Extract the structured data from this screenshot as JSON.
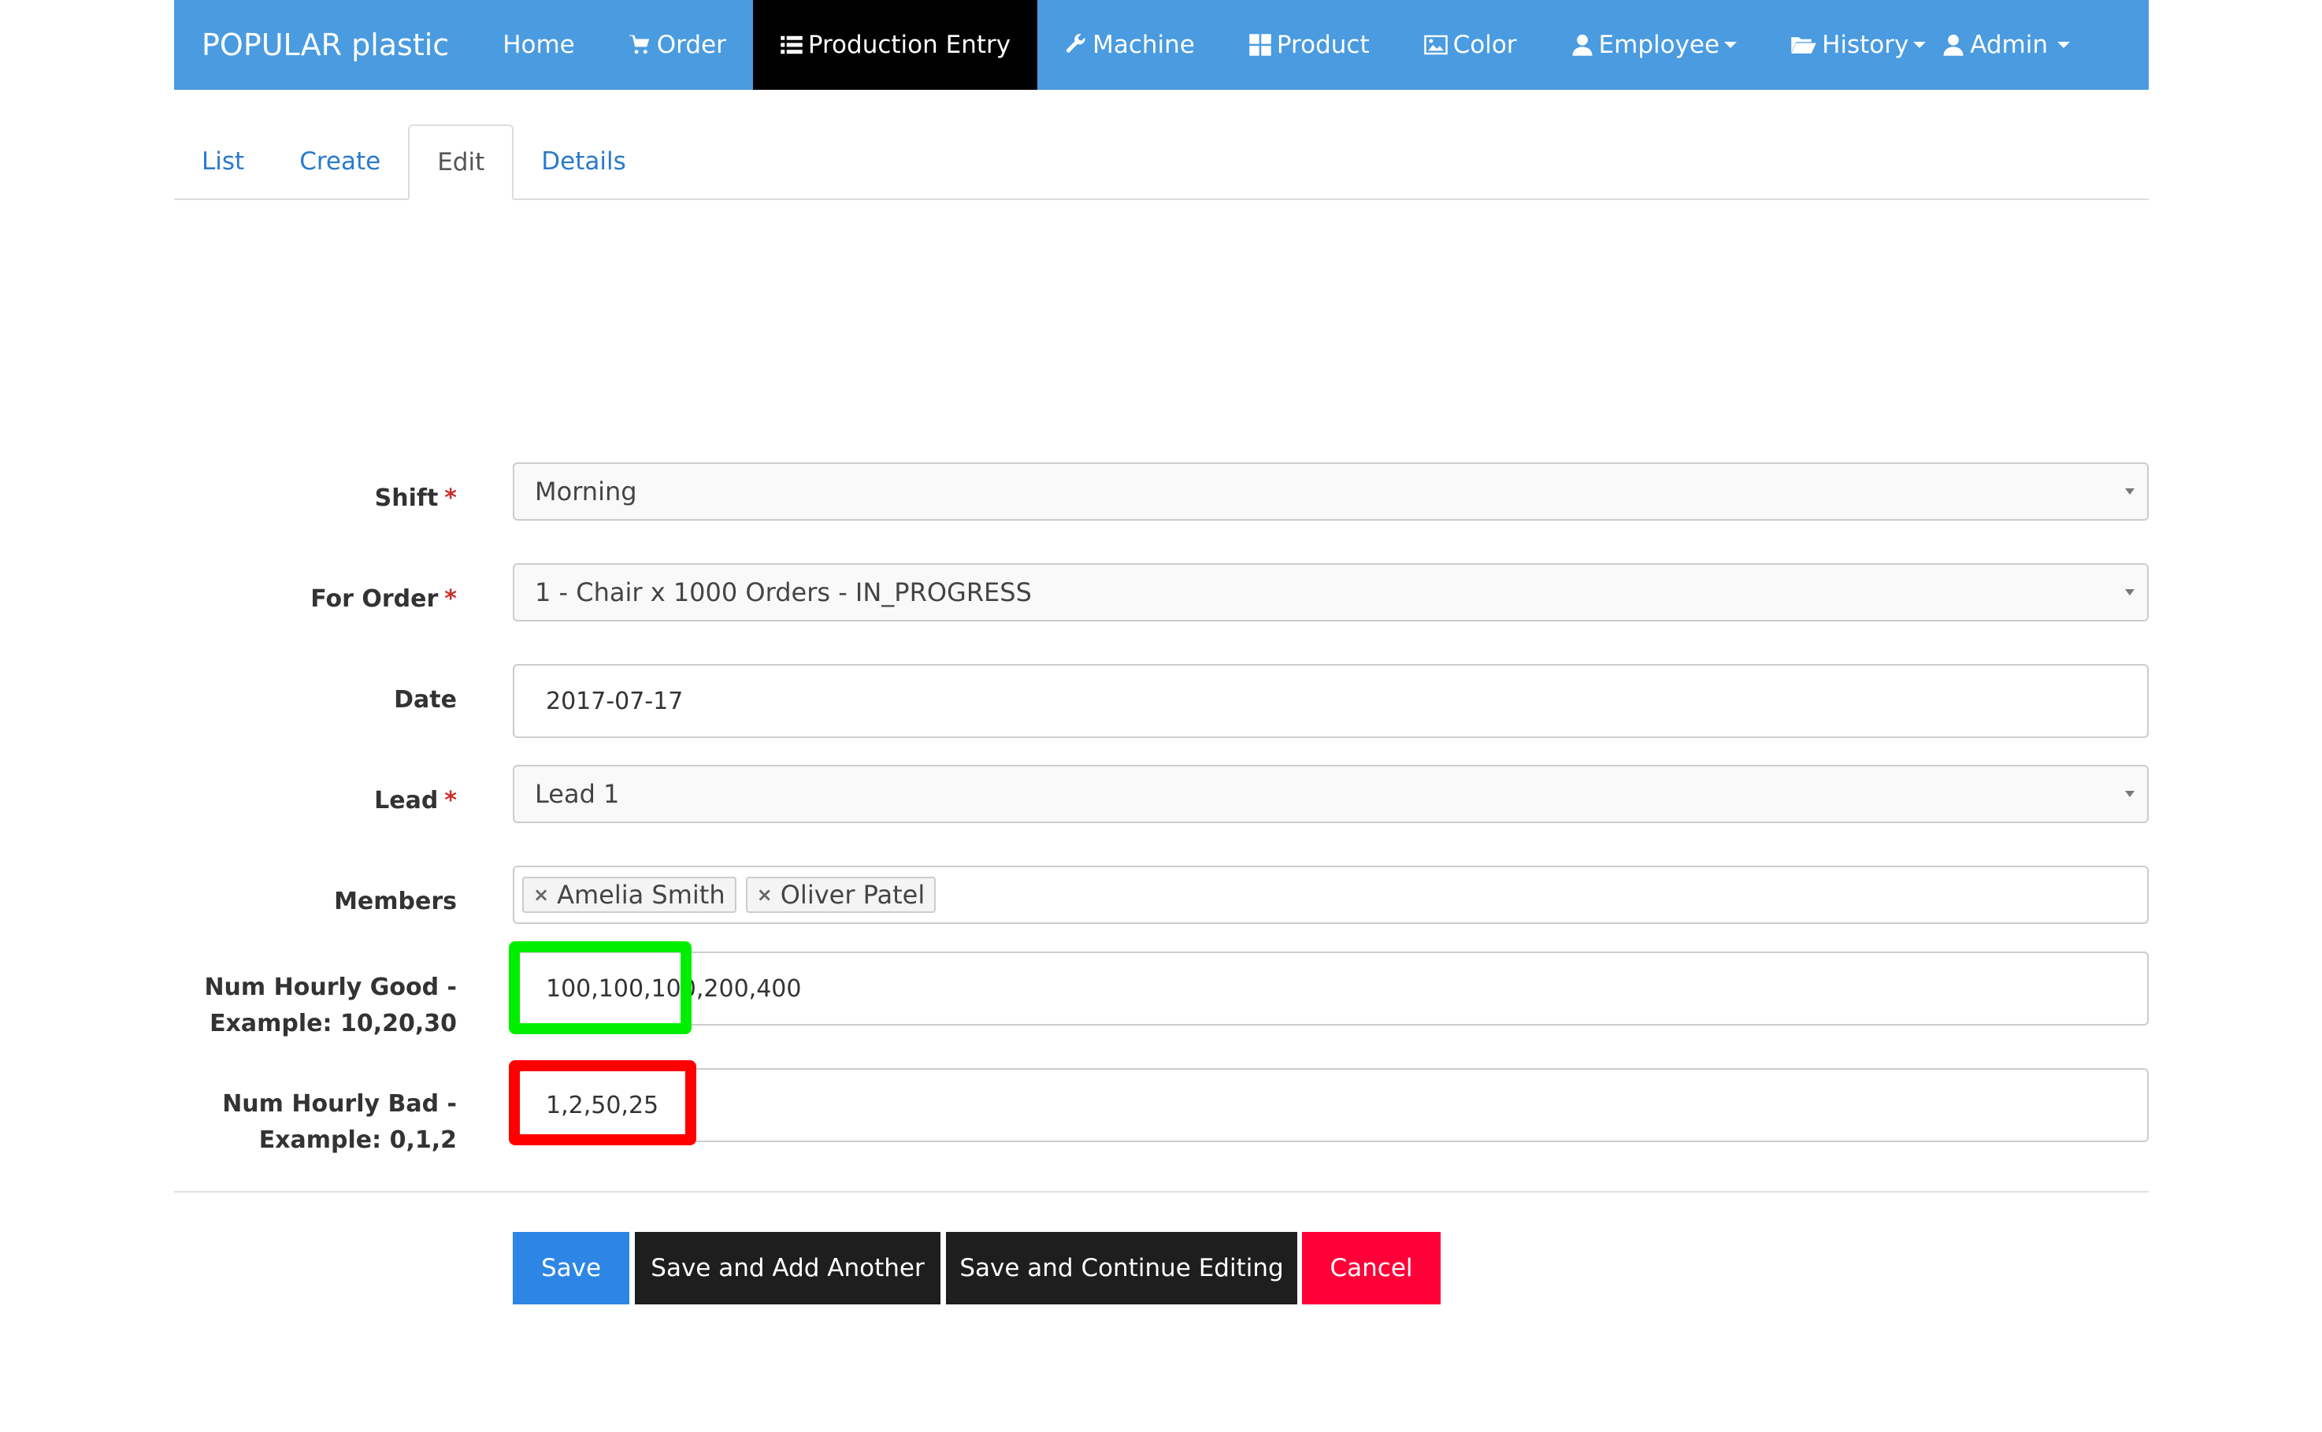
{
  "navbar": {
    "brand": "POPULAR plastic",
    "items": [
      {
        "label": "Home",
        "icon": "none"
      },
      {
        "label": "Order",
        "icon": "cart-icon"
      },
      {
        "label": "Production Entry",
        "icon": "list-icon",
        "active": true
      },
      {
        "label": "Machine",
        "icon": "wrench-icon"
      },
      {
        "label": "Product",
        "icon": "grid-icon"
      },
      {
        "label": "Color",
        "icon": "picture-icon"
      },
      {
        "label": "Employee",
        "icon": "user-icon",
        "dropdown": true
      },
      {
        "label": "History",
        "icon": "folder-open-icon",
        "dropdown": true
      }
    ],
    "user": {
      "label": "Admin",
      "icon": "user-icon",
      "dropdown": true
    },
    "colors": {
      "background": "#4a9be0",
      "active": "#000000",
      "text": "#ffffff"
    }
  },
  "tabs": [
    {
      "label": "List"
    },
    {
      "label": "Create"
    },
    {
      "label": "Edit",
      "active": true
    },
    {
      "label": "Details"
    }
  ],
  "form": {
    "shift": {
      "label": "Shift",
      "required": "*",
      "value": "Morning"
    },
    "for_order": {
      "label": "For Order",
      "required": "*",
      "value": "1 - Chair x 1000 Orders - IN_PROGRESS"
    },
    "date": {
      "label": "Date",
      "value": "2017-07-17"
    },
    "lead": {
      "label": "Lead",
      "required": "*",
      "value": "Lead 1"
    },
    "members": {
      "label": "Members",
      "tags": [
        "Amelia Smith",
        "Oliver Patel"
      ],
      "remove_glyph": "×"
    },
    "num_hourly_good": {
      "label_line1": "Num Hourly Good -",
      "label_line2": "Example: 10,20,30",
      "value": "100,100,100,200,400"
    },
    "num_hourly_bad": {
      "label_line1": "Num Hourly Bad -",
      "label_line2": "Example: 0,1,2",
      "value": "1,2,50,25"
    }
  },
  "buttons": {
    "save": "Save",
    "save_add_another": "Save and Add Another",
    "save_continue": "Save and Continue Editing",
    "cancel": "Cancel"
  },
  "highlight_colors": {
    "good": "#00ee00",
    "bad": "#ff0000"
  }
}
